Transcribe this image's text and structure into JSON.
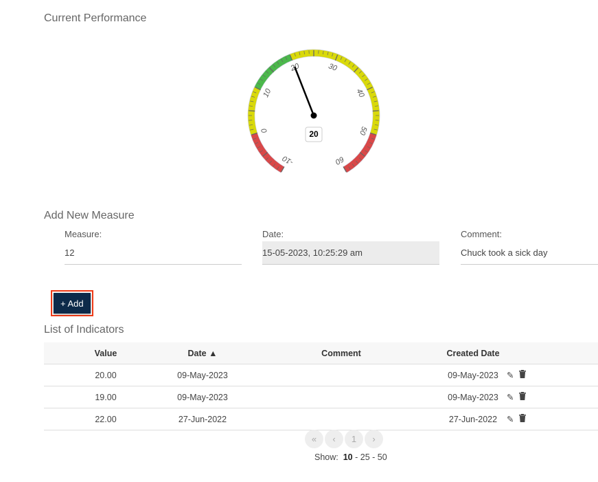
{
  "performance": {
    "title": "Current Performance",
    "gauge": {
      "min": -10,
      "max": 60,
      "value": 20,
      "value_label": "20",
      "ticks": [
        "-10",
        "0",
        "10",
        "20",
        "30",
        "40",
        "50",
        "60"
      ],
      "bands": [
        {
          "from": -10,
          "to": 0,
          "color": "#d94848"
        },
        {
          "from": 0,
          "to": 10,
          "color": "#d9d90a"
        },
        {
          "from": 10,
          "to": 20,
          "color": "#4bb84b"
        },
        {
          "from": 20,
          "to": 50,
          "color": "#d9d90a"
        },
        {
          "from": 50,
          "to": 60,
          "color": "#d94848"
        }
      ]
    }
  },
  "form": {
    "title": "Add New Measure",
    "measure": {
      "label": "Measure:",
      "value": "12"
    },
    "date": {
      "label": "Date:",
      "value": "15-05-2023, 10:25:29 am"
    },
    "comment": {
      "label": "Comment:",
      "value": "Chuck took a sick day"
    },
    "add_label": "+ Add"
  },
  "list": {
    "title": "List of Indicators",
    "headers": [
      "Value",
      "Date ▲",
      "Comment",
      "Created Date"
    ],
    "rows": [
      {
        "value": "20.00",
        "date": "09-May-2023",
        "comment": "",
        "created": "09-May-2023"
      },
      {
        "value": "19.00",
        "date": "09-May-2023",
        "comment": "",
        "created": "09-May-2023"
      },
      {
        "value": "22.00",
        "date": "27-Jun-2022",
        "comment": "",
        "created": "27-Jun-2022"
      }
    ],
    "pager": {
      "first": "«",
      "prev": "‹",
      "page": "1",
      "next": "›"
    },
    "show": {
      "label": "Show:",
      "options": [
        "10",
        "25",
        "50"
      ],
      "sep": "-"
    }
  }
}
